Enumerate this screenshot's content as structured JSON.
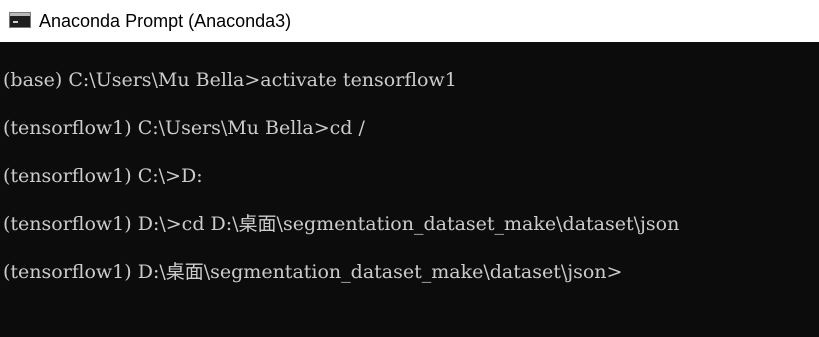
{
  "window": {
    "title": "Anaconda Prompt (Anaconda3)",
    "icon": "terminal-icon"
  },
  "console": {
    "lines": [
      "(base) C:\\Users\\Mu Bella>activate tensorflow1",
      "(tensorflow1) C:\\Users\\Mu Bella>cd /",
      "(tensorflow1) C:\\>D:",
      "(tensorflow1) D:\\>cd D:\\桌面\\segmentation_dataset_make\\dataset\\json",
      "(tensorflow1) D:\\桌面\\segmentation_dataset_make\\dataset\\json>"
    ]
  },
  "colors": {
    "console_background": "#0c0c0c",
    "console_text": "#cccccc",
    "titlebar_background": "#ffffff",
    "title_text": "#000000"
  }
}
